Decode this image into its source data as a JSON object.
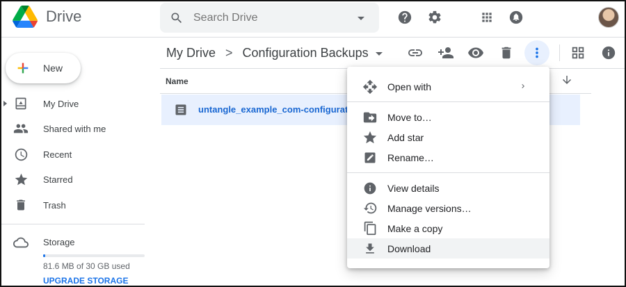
{
  "app": {
    "name": "Drive"
  },
  "search": {
    "placeholder": "Search Drive"
  },
  "sidebar": {
    "new_label": "New",
    "items": [
      {
        "label": "My Drive"
      },
      {
        "label": "Shared with me"
      },
      {
        "label": "Recent"
      },
      {
        "label": "Starred"
      },
      {
        "label": "Trash"
      }
    ],
    "storage": {
      "label": "Storage",
      "used_text": "81.6 MB of 30 GB used",
      "used_fraction": 0.003,
      "upgrade_label": "UPGRADE STORAGE"
    }
  },
  "breadcrumb": {
    "root": "My Drive",
    "separator": ">",
    "current": "Configuration Backups"
  },
  "file_list": {
    "column_name": "Name",
    "files": [
      {
        "name": "untangle_example_com-configuration_ba"
      }
    ]
  },
  "context_menu": {
    "items": [
      {
        "label": "Open with",
        "icon": "open-with-icon"
      },
      {
        "label": "Move to…",
        "icon": "move-to-icon"
      },
      {
        "label": "Add star",
        "icon": "star-icon"
      },
      {
        "label": "Rename…",
        "icon": "rename-icon"
      },
      {
        "label": "View details",
        "icon": "info-icon"
      },
      {
        "label": "Manage versions…",
        "icon": "history-icon"
      },
      {
        "label": "Make a copy",
        "icon": "copy-icon"
      },
      {
        "label": "Download",
        "icon": "download-icon"
      }
    ]
  },
  "colors": {
    "accent": "#1a73e8",
    "selected_row": "#e8f0fe",
    "icon_gray": "#5f6368"
  }
}
